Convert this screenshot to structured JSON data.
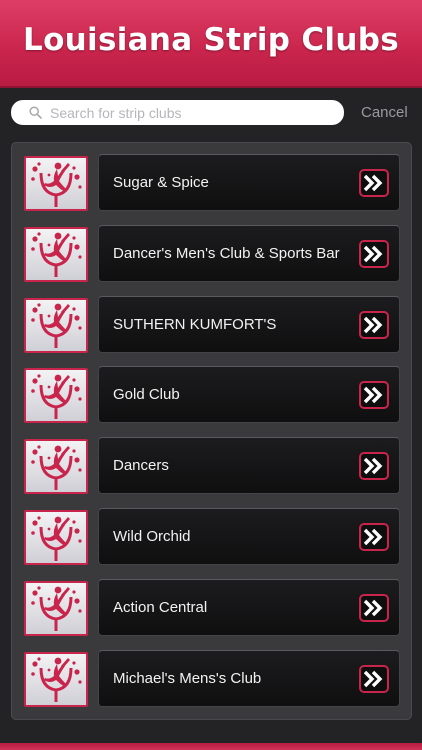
{
  "header": {
    "title": "Louisiana Strip Clubs"
  },
  "search": {
    "placeholder": "Search for strip clubs",
    "value": "",
    "cancel_label": "Cancel"
  },
  "colors": {
    "accent": "#c9244c",
    "background": "#232325",
    "panel": "#3a3a3d"
  },
  "list": {
    "items": [
      {
        "label": "Sugar & Spice",
        "icon": "dancer-thumbnail",
        "action_icon": "double-chevron-right-icon"
      },
      {
        "label": "Dancer's Men's Club & Sports Bar",
        "icon": "dancer-thumbnail",
        "action_icon": "double-chevron-right-icon"
      },
      {
        "label": "SUTHERN KUMFORT'S",
        "icon": "dancer-thumbnail",
        "action_icon": "double-chevron-right-icon"
      },
      {
        "label": "Gold Club",
        "icon": "dancer-thumbnail",
        "action_icon": "double-chevron-right-icon"
      },
      {
        "label": "Dancers",
        "icon": "dancer-thumbnail",
        "action_icon": "double-chevron-right-icon"
      },
      {
        "label": "Wild Orchid",
        "icon": "dancer-thumbnail",
        "action_icon": "double-chevron-right-icon"
      },
      {
        "label": "Action Central",
        "icon": "dancer-thumbnail",
        "action_icon": "double-chevron-right-icon"
      },
      {
        "label": "Michael's Mens's Club",
        "icon": "dancer-thumbnail",
        "action_icon": "double-chevron-right-icon"
      }
    ]
  }
}
